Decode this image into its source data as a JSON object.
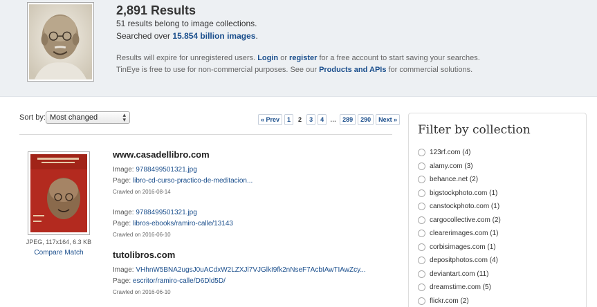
{
  "header": {
    "results_count": "2,891 Results",
    "collections_text": "51 results belong to image collections.",
    "searched_prefix": "Searched over ",
    "searched_amount": "15.854 billion images",
    "searched_suffix": ".",
    "expire_prefix": "Results will expire for unregistered users. ",
    "login_label": "Login",
    "or_text": " or ",
    "register_label": "register",
    "expire_suffix": " for a free account to start saving your searches.",
    "free_prefix": "TinEye is free to use for non-commercial purposes. See our ",
    "products_label": "Products and APIs",
    "free_suffix": " for commercial solutions."
  },
  "sort": {
    "label": "Sort by:",
    "selected": "Most changed"
  },
  "pagination": {
    "prev": "« Prev",
    "pages": [
      "1",
      "2",
      "3",
      "4",
      "…",
      "289",
      "290"
    ],
    "current": "2",
    "next": "Next »"
  },
  "match": {
    "meta": "JPEG, 117x164, 6.3 KB",
    "compare_label": "Compare Match"
  },
  "results": [
    {
      "site": "www.casadellibro.com",
      "entries": [
        {
          "image_label": "Image: ",
          "image_file": "9788499501321.jpg",
          "page_label": "Page: ",
          "page_url": "libro-cd-curso-practico-de-meditacion...",
          "crawled": "Crawled on 2016-08-14"
        },
        {
          "image_label": "Image: ",
          "image_file": "9788499501321.jpg",
          "page_label": "Page: ",
          "page_url": "libros-ebooks/ramiro-calle/13143",
          "crawled": "Crawled on 2016-06-10"
        }
      ]
    },
    {
      "site": "tutolibros.com",
      "entries": [
        {
          "image_label": "Image: ",
          "image_file": "VHhnW5BNA2ugsJ0uACdxW2LZXJl7VJGlkI9fk2nNseF7AcbIAwTIAwZcy...",
          "page_label": "Page: ",
          "page_url": "escritor/ramiro-calle/D6Dld5D/",
          "crawled": "Crawled on 2016-06-10"
        }
      ]
    }
  ],
  "filter": {
    "title": "Filter by collection",
    "items": [
      "123rf.com (4)",
      "alamy.com (3)",
      "behance.net (2)",
      "bigstockphoto.com (1)",
      "canstockphoto.com (1)",
      "cargocollective.com (2)",
      "clearerimages.com (1)",
      "corbisimages.com (1)",
      "depositphotos.com (4)",
      "deviantart.com (11)",
      "dreamstime.com (5)",
      "flickr.com (2)"
    ]
  },
  "colors": {
    "link": "#1a4e8c",
    "header_bg": "#edf0f3",
    "book_cover": "#b32a1f"
  },
  "icons": {
    "query_image": "portrait-photo",
    "match_image": "book-cover-thumbnail",
    "dropdown": "updown-caret-icon",
    "filter_option": "radio-button-icon"
  }
}
